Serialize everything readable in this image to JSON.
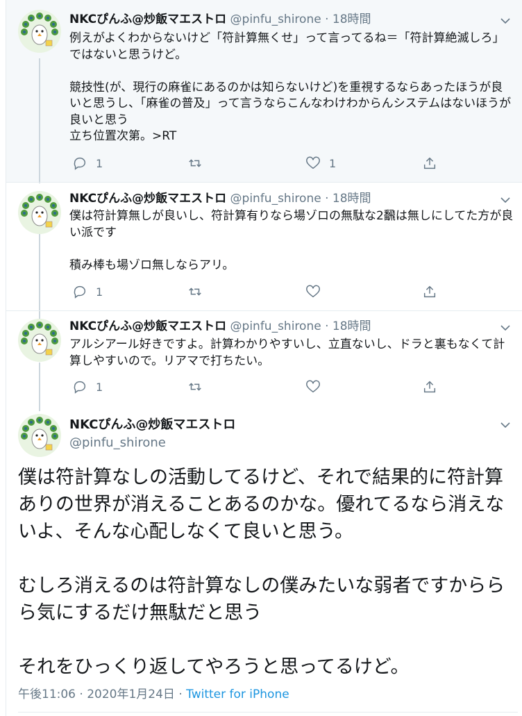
{
  "tweets": [
    {
      "name": "NKCぴんふ@炒飯マエストロ",
      "handle": "@pinfu_shirone",
      "dot": "·",
      "time": "18時間",
      "text": "例えがよくわからないけど「符計算無くせ」って言ってるね＝「符計算絶滅しろ」ではないと思うけど。\n\n競技性(が、現行の麻雀にあるのかは知らないけど)を重視するならあったほうが良いと思うし、「麻雀の普及」って言うならこんなわけわからんシステムはないほうが良いと思う\n立ち位置次第。>RT",
      "reply_count": "1",
      "retweet_count": "",
      "like_count": "1"
    },
    {
      "name": "NKCぴんふ@炒飯マエストロ",
      "handle": "@pinfu_shirone",
      "dot": "·",
      "time": "18時間",
      "text": "僕は符計算無しが良いし、符計算有りなら場ゾロの無駄な2飜は無しにしてた方が良い派です\n\n積み棒も場ゾロ無しならアリ。",
      "reply_count": "1",
      "retweet_count": "",
      "like_count": ""
    },
    {
      "name": "NKCぴんふ@炒飯マエストロ",
      "handle": "@pinfu_shirone",
      "dot": "·",
      "time": "18時間",
      "text": "アルシアール好きですよ。計算わかりやすいし、立直ないし、ドラと裏もなくて計算しやすいので。リアマで打ちたい。",
      "reply_count": "1",
      "retweet_count": "",
      "like_count": ""
    }
  ],
  "main_tweet": {
    "name": "NKCぴんふ@炒飯マエストロ",
    "handle": "@pinfu_shirone",
    "text": "僕は符計算なしの活動してるけど、それで結果的に符計算ありの世界が消えることあるのかな。優れてるなら消えないよ、そんな心配しなくて良いと思う。\n\nむしろ消えるのは符計算なしの僕みたいな弱者ですかららら気にするだけ無駄だと思う\n\nそれをひっくり返してやろうと思ってるけど。",
    "timestamp": "午後11:06 · 2020年1月24日 · ",
    "source": "Twitter for iPhone"
  },
  "icons": {
    "reply": "reply-icon",
    "retweet": "retweet-icon",
    "like": "heart-icon",
    "share": "share-icon",
    "caret": "chevron-down-icon",
    "avatar": "peacock-avatar"
  },
  "colors": {
    "secondary_text": "#657786",
    "link": "#1b95e0",
    "highlight_bg": "#f5f8fa",
    "thread_line": "#ccd6dd"
  }
}
